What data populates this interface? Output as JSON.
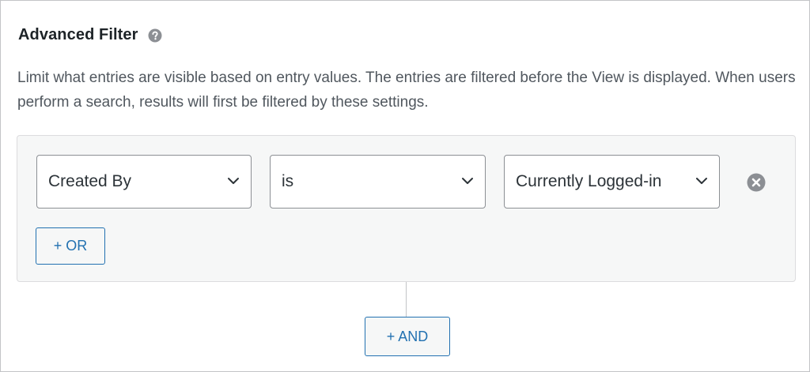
{
  "header": {
    "title": "Advanced Filter",
    "help_icon": "question-circle-icon"
  },
  "description": "Limit what entries are visible based on entry values. The entries are filtered before the View is displayed. When users perform a search, results will first be filtered by these settings.",
  "filter_group": {
    "condition": {
      "field": "Created By",
      "operator": "is",
      "value": "Currently Logged-in"
    },
    "remove_icon": "remove-circle-icon",
    "or_button_label": "+ OR"
  },
  "and_button_label": "+ AND",
  "colors": {
    "accent": "#2271b1",
    "panel_bg": "#f6f7f7",
    "border": "#8c8f94",
    "text": "#50575e"
  }
}
